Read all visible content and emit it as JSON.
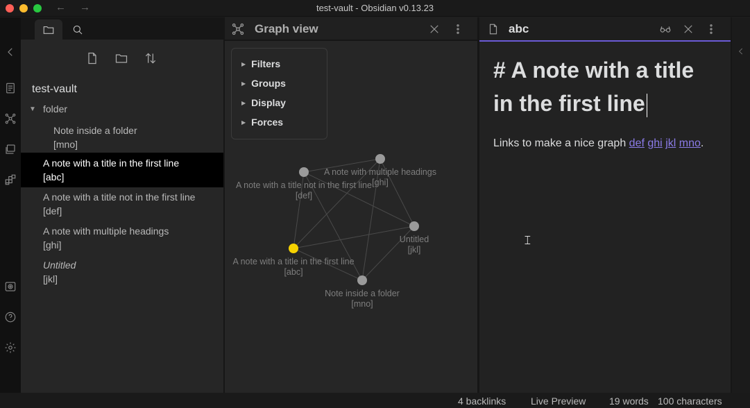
{
  "window": {
    "title": "test-vault - Obsidian v0.13.23",
    "back_arrow": "←",
    "forward_arrow": "→"
  },
  "ribbon": {
    "icons": [
      "collapse-left-icon",
      "switcher-icon",
      "graph-icon",
      "slides-icon",
      "blocks-icon",
      "vault-icon",
      "help-icon",
      "settings-icon"
    ]
  },
  "file_explorer": {
    "tabs": [
      "folder-icon",
      "search-icon"
    ],
    "actions": [
      "new-note-icon",
      "new-folder-icon",
      "sort-icon"
    ],
    "vault_name": "test-vault",
    "folder": {
      "name": "folder",
      "expanded": true
    },
    "files": [
      {
        "title": "Note inside a folder",
        "alias": "[mno]",
        "in_folder": true
      },
      {
        "title": "A note with a title in the first line",
        "alias": "[abc]",
        "active": true
      },
      {
        "title": "A note with a title not in the first line",
        "alias": "[def]"
      },
      {
        "title": "A note with multiple headings",
        "alias": "[ghi]"
      },
      {
        "title": "Untitled",
        "alias": "[jkl]",
        "italic": true
      }
    ]
  },
  "graph_view": {
    "title": "Graph view",
    "filters": [
      "Filters",
      "Groups",
      "Display",
      "Forces"
    ],
    "nodes": [
      {
        "id": "ghi",
        "label": "A note with multiple headings",
        "alias": "[ghi]"
      },
      {
        "id": "def",
        "label": "A note with a title not in the first line",
        "alias": "[def]"
      },
      {
        "id": "jkl",
        "label": "Untitled",
        "alias": "[jkl]"
      },
      {
        "id": "abc",
        "label": "A note with a title in the first line",
        "alias": "[abc]",
        "active": true
      },
      {
        "id": "mno",
        "label": "Note inside a folder",
        "alias": "[mno]"
      }
    ],
    "edges": [
      [
        "def",
        "ghi"
      ],
      [
        "def",
        "jkl"
      ],
      [
        "def",
        "abc"
      ],
      [
        "def",
        "mno"
      ],
      [
        "ghi",
        "jkl"
      ],
      [
        "ghi",
        "abc"
      ],
      [
        "ghi",
        "mno"
      ],
      [
        "abc",
        "jkl"
      ],
      [
        "abc",
        "mno"
      ],
      [
        "jkl",
        "mno"
      ]
    ],
    "colors": {
      "node": "#9a9a9a",
      "active_node": "#f5d100",
      "edge": "#4a4a4a",
      "label": "#7e7e7e"
    }
  },
  "editor": {
    "tab_title": "abc",
    "heading_line1": "# A note with a title",
    "heading_line2": "in the first line",
    "paragraph_text": "Links to make a nice graph",
    "links": [
      "def",
      "ghi",
      "jkl",
      "mno"
    ],
    "paragraph_end": "."
  },
  "status_bar": {
    "backlinks": "4 backlinks",
    "mode": "Live Preview",
    "words": "19 words",
    "characters": "100 characters"
  }
}
